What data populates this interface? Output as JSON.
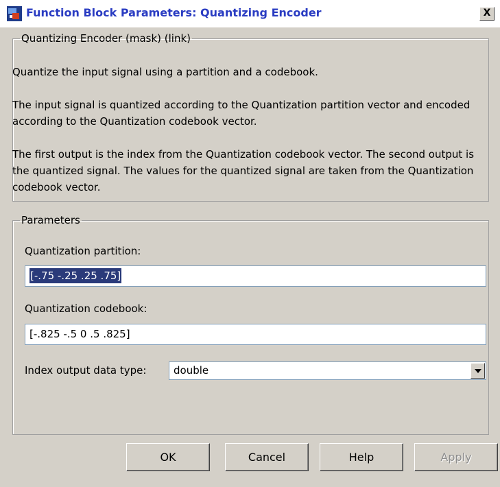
{
  "window": {
    "title": "Function Block Parameters: Quantizing Encoder",
    "close_label": "X"
  },
  "description": {
    "legend": "Quantizing Encoder (mask) (link)",
    "paragraph1": "Quantize the input signal using a partition and a codebook.",
    "paragraph2": "The input signal is quantized according to the Quantization partition vector and encoded according to the Quantization codebook vector.",
    "paragraph3": "The first output is the index from the Quantization codebook vector. The second output is the quantized signal.  The values for the quantized signal are taken from the Quantization codebook vector."
  },
  "parameters": {
    "legend": "Parameters",
    "partition_label": "Quantization partition:",
    "partition_value": "[-.75 -.25 .25 .75]",
    "codebook_label": "Quantization codebook:",
    "codebook_value": "[-.825 -.5 0 .5 .825]",
    "index_type_label": "Index output data type:",
    "index_type_value": "double"
  },
  "buttons": {
    "ok": "OK",
    "cancel": "Cancel",
    "help": "Help",
    "apply": "Apply"
  }
}
